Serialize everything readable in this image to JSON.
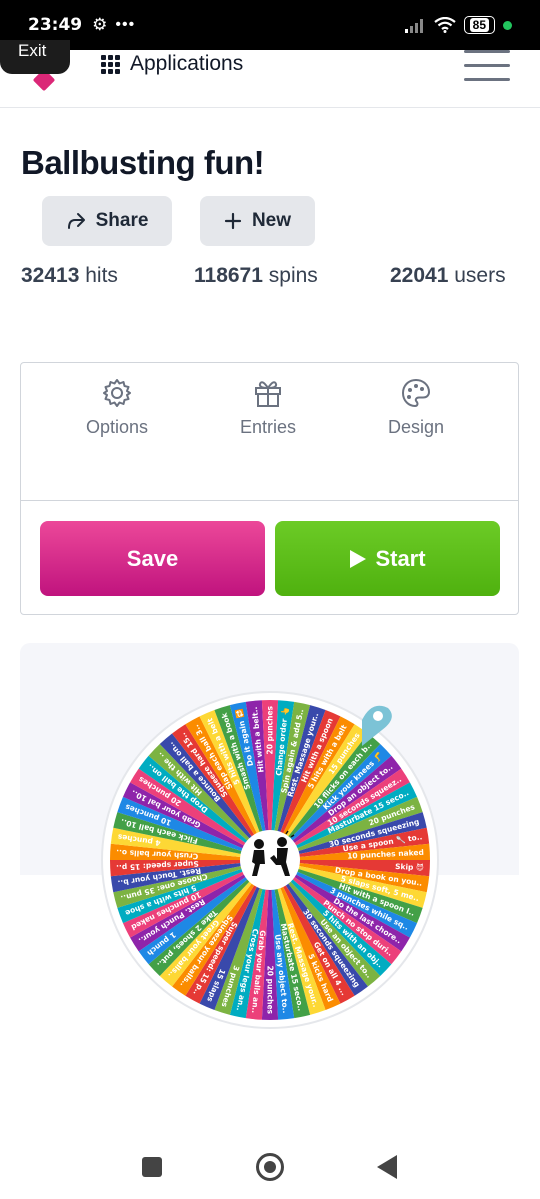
{
  "status_bar": {
    "time": "23:49",
    "battery": "85"
  },
  "exit_label": "Exit",
  "header": {
    "apps_label": "Applications"
  },
  "page": {
    "title": "Ballbusting fun!",
    "share_label": "Share",
    "new_label": "New"
  },
  "stats": {
    "hits_value": "32413",
    "hits_label": "hits",
    "spins_value": "118671",
    "spins_label": "spins",
    "users_value": "22041",
    "users_label": "users"
  },
  "tools": {
    "options_label": "Options",
    "entries_label": "Entries",
    "design_label": "Design",
    "save_label": "Save",
    "start_label": "Start"
  },
  "wheel": {
    "segment_colors": [
      "#e53935",
      "#fb8c00",
      "#fdd835",
      "#43a047",
      "#1e88e5",
      "#8e24aa",
      "#ec407a",
      "#00acc1",
      "#7cb342",
      "#3949ab"
    ],
    "entries": [
      "Skip 😈",
      "Drop a book on you..",
      "5 slaps soft, 5 me..",
      "Hit with a spoon I..",
      "3 punches while sq..",
      "Do the last chore..",
      "Punch no stop duri..",
      "5 hits with an obj..",
      "Use an object to..",
      "30 seconds squeezing",
      "Get on all 4 ...",
      "5 kicks hard",
      "Rest. Massage your..",
      "Masturbate 15 seco..",
      "Use any object to..",
      "20 punches",
      "Grab your balls an..",
      "Cross your legs an..",
      "3 punches",
      "15 slaps",
      "Super speed: 15 p..",
      "Squeeze your balls..",
      "Greet your balls..",
      "Take 2 shoes, put..",
      "1 punch",
      "Rest. Punch your..",
      "10 punches naked",
      "5 hits with a shoe",
      "Choose one: 35 pun..",
      "Rest. Touch your b..",
      "Super speed: 15 p..",
      "Crush your balls o..",
      "4 punches",
      "Flick each ball 10..",
      "10 punches",
      "Grab your bal 10..",
      "20 punches",
      "Drop the ball on..",
      "Hit with the ..",
      "Bounce a ball on..",
      "Squeeze hard 15..",
      "Slap each ball 3..",
      "5 hits with a belt",
      "Smash with a book",
      "Do it again 🔁",
      "Hit with a belt..",
      "20 punches",
      "Change order 👆",
      "Spin again & add 5..",
      "Rest. Massage your..",
      "Hit with a spoon",
      "5 hits with a belt",
      "15 punches",
      "10 flicks on each b..",
      "Kick your knees 🦵",
      "Drop an object to..",
      "10 seconds squeez..",
      "Masturbate 15 seco..",
      "20 punches",
      "30 seconds squeezing",
      "Use a spoon 🥄 to..",
      "10 punches naked"
    ]
  }
}
